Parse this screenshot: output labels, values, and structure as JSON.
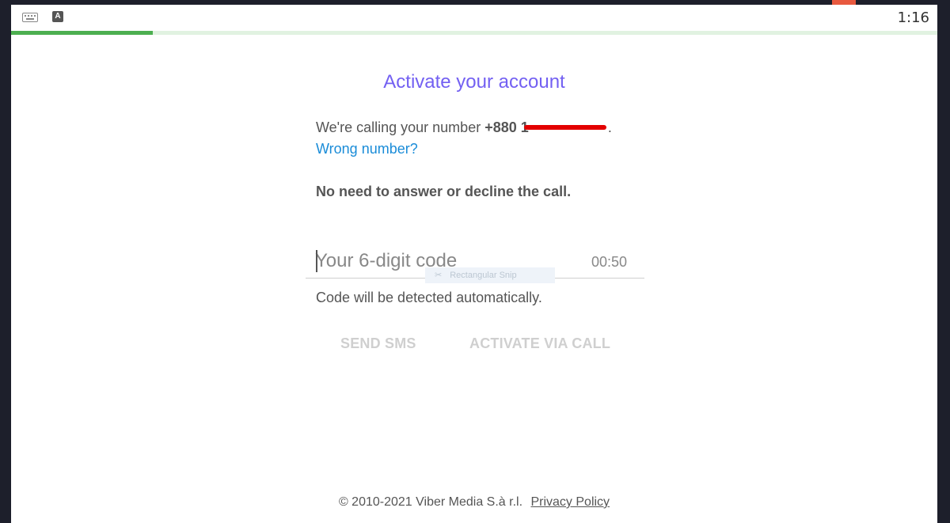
{
  "status_bar": {
    "time": "1:16",
    "icons": [
      "keyboard-icon",
      "a-icon"
    ],
    "a_icon_label": "A"
  },
  "progress": {
    "fraction": 0.153,
    "fill_color": "#4caf50",
    "track_color": "#e1f2e1"
  },
  "title": "Activate your account",
  "calling": {
    "prefix": "We're calling your number",
    "country_code": "+880",
    "number_visible_digit": "1",
    "redacted": true,
    "suffix": "."
  },
  "wrong_number_label": "Wrong number?",
  "no_need_text": "No need to answer or decline the call.",
  "code_input": {
    "placeholder": "Your 6-digit code",
    "value": "",
    "timer": "00:50"
  },
  "snip_overlay_label": "Rectangular Snip",
  "auto_detect_text": "Code will be detected automatically.",
  "buttons": {
    "send_sms": "SEND SMS",
    "activate_via_call": "ACTIVATE VIA CALL"
  },
  "footer": {
    "copyright": "© 2010-2021 Viber Media S.à r.l.",
    "privacy_link": "Privacy Policy"
  },
  "colors": {
    "title": "#7360f2",
    "link": "#1a8cd8",
    "redaction": "#e30000",
    "disabled_button": "#cfcfcf"
  }
}
